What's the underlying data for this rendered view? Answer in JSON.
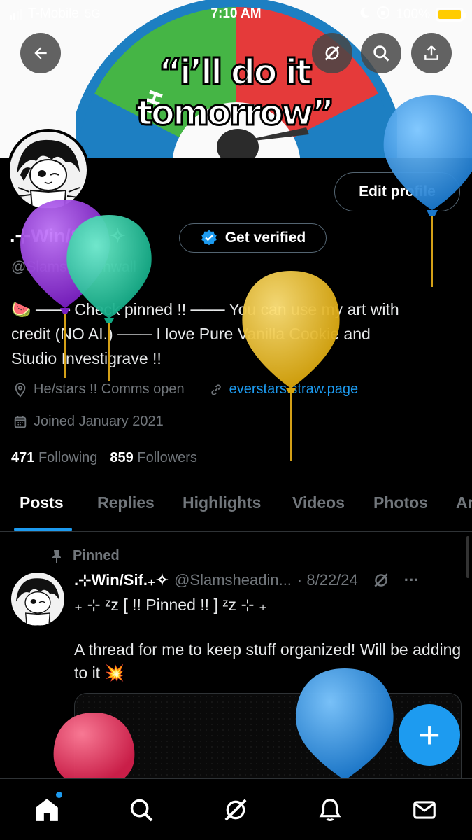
{
  "status_bar": {
    "carrier": "T-Mobile",
    "network": "5G",
    "time": "7:10 AM",
    "battery": "100%",
    "battery_level": 1.0
  },
  "banner": {
    "caption": "“i’ll do it tomorrow”",
    "gauge_label": "TH"
  },
  "profile": {
    "edit_profile_label": "Edit profile",
    "display_name": ".⊹Win/Sif.₊✧",
    "get_verified_label": "Get verified",
    "handle": "@Slamsheadinwall",
    "bio_lines": [
      "🍉 ─── Check pinned !! ─── You can use my art with",
      "credit (NO AI.) ─── I love Pure Vanilla Cookie and",
      "Studio Investigrave !!"
    ],
    "location": "He/stars !!  Comms open",
    "website": "everstars.straw.page",
    "joined": "Joined January 2021",
    "following_count": "471",
    "following_label": "Following",
    "followers_count": "859",
    "followers_label": "Followers"
  },
  "tabs": [
    "Posts",
    "Replies",
    "Highlights",
    "Videos",
    "Photos",
    "Articles"
  ],
  "active_tab": "Posts",
  "pinned_post": {
    "pinned_label": "Pinned",
    "author_name": ".⊹Win/Sif.₊✧",
    "author_handle": "@Slamsheadin...",
    "date": "· 8/22/24",
    "more_label": "···",
    "line1": "₊ ⊹ ᶻz [ !! Pinned !! ] ᶻz ⊹ ₊",
    "line2": "A thread for me to keep stuff organized! Will be adding to it 💥"
  },
  "fab_label": "+",
  "bottom_nav": [
    "home-icon",
    "search-icon",
    "grok-icon",
    "notifications-icon",
    "messages-icon"
  ],
  "colors": {
    "accent": "#1d9bf0",
    "background": "#000000",
    "secondary_text": "#71767b",
    "balloon_purple": "#8e2fd0",
    "balloon_teal": "#22c9a0",
    "balloon_yellow": "#e8b71a",
    "balloon_blue": "#2a8ee0",
    "balloon_red": "#e0305a"
  }
}
